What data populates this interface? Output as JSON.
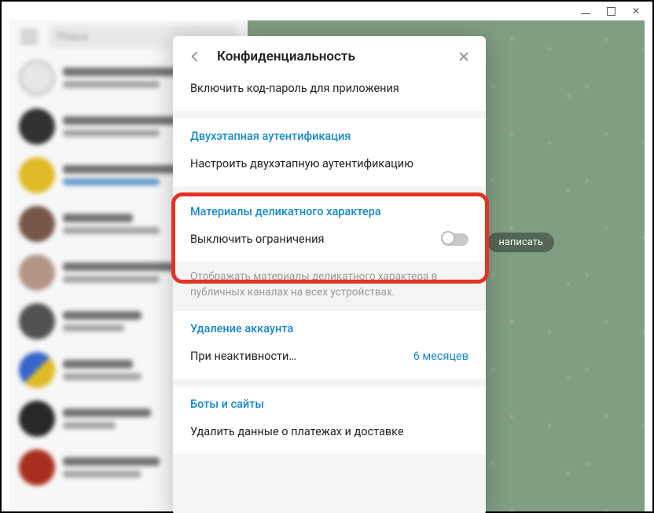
{
  "search": {
    "placeholder": "Поиск"
  },
  "main": {
    "write_hint": "написать"
  },
  "dialog": {
    "title": "Конфиденциальность",
    "passcode_row": "Включить код-пароль для приложения",
    "two_step": {
      "heading": "Двухэтапная аутентификация",
      "row": "Настроить двухэтапную аутентификацию"
    },
    "sensitive": {
      "heading": "Материалы деликатного характера",
      "row": "Выключить ограничения",
      "desc": "Отображать материалы деликатного характера в публичных каналах на всех устройствах."
    },
    "delete": {
      "heading": "Удаление аккаунта",
      "row_label": "При неактивности…",
      "row_value": "6 месяцев"
    },
    "bots": {
      "heading": "Боты и сайты",
      "row": "Удалить данные о платежах и доставке"
    }
  }
}
